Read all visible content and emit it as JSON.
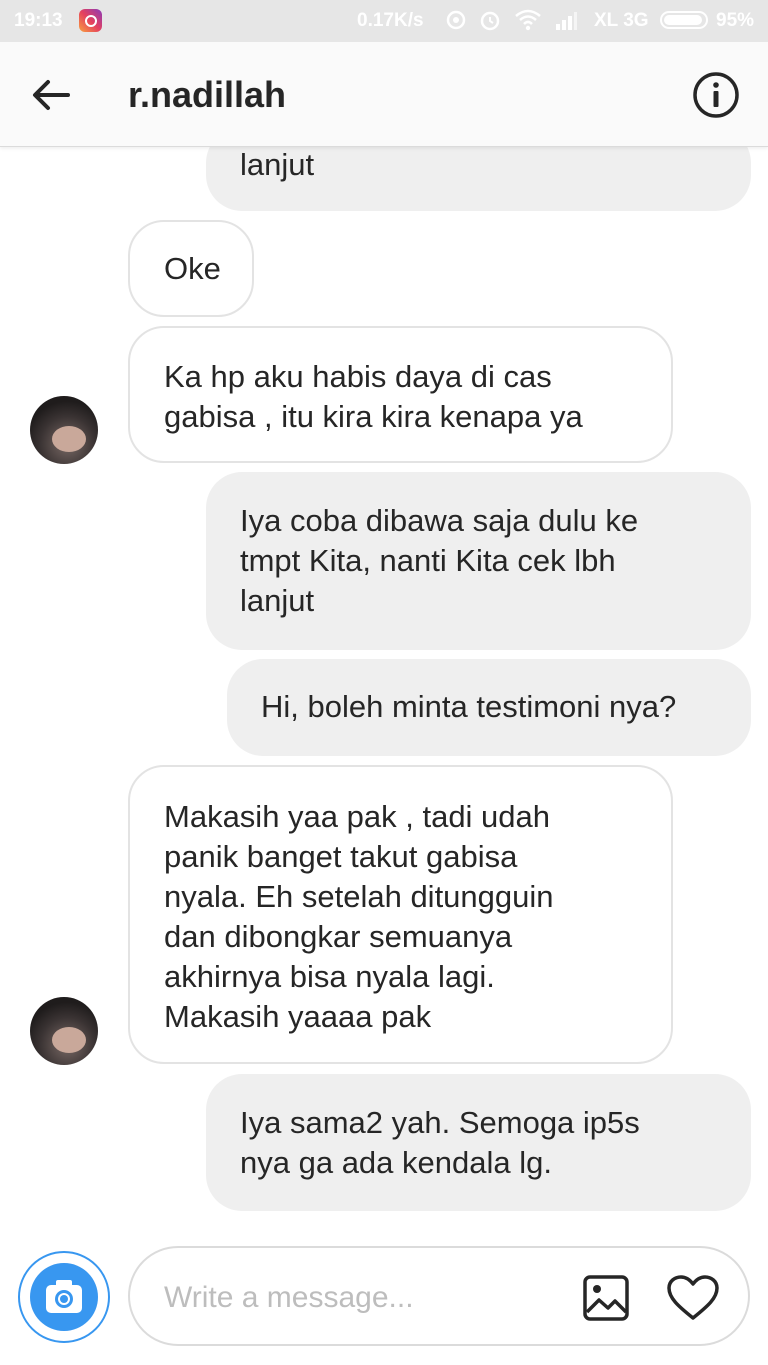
{
  "status_bar": {
    "time": "19:13",
    "network_speed": "0.17K/s",
    "carrier": "XL 3G",
    "battery": "95%",
    "battery_level": 0.95
  },
  "header": {
    "title": "r.nadillah",
    "back_icon": "arrow-left-icon",
    "info_icon": "info-icon"
  },
  "messages": [
    {
      "direction": "outgoing",
      "lines": [
        "lanjut"
      ]
    },
    {
      "direction": "incoming",
      "lines": [
        "Oke"
      ]
    },
    {
      "direction": "incoming",
      "lines": [
        "Ka hp aku habis daya di cas",
        "gabisa , itu kira kira kenapa ya"
      ]
    },
    {
      "direction": "outgoing",
      "lines": [
        "Iya coba dibawa saja dulu ke",
        "tmpt Kita, nanti Kita cek lbh",
        "lanjut"
      ]
    },
    {
      "direction": "outgoing",
      "lines": [
        "Hi, boleh minta testimoni nya?"
      ]
    },
    {
      "direction": "incoming",
      "lines": [
        "Makasih yaa pak , tadi udah",
        "panik banget takut gabisa",
        "nyala. Eh setelah ditungguin",
        "dan dibongkar semuanya",
        "akhirnya bisa nyala lagi.",
        "Makasih yaaaa pak"
      ]
    },
    {
      "direction": "outgoing",
      "lines": [
        "Iya sama2 yah. Semoga ip5s",
        "nya ga ada kendala lg."
      ]
    }
  ],
  "composer": {
    "placeholder": "Write a message...",
    "camera_icon": "camera-icon",
    "gallery_icon": "image-icon",
    "like_icon": "heart-icon"
  },
  "colors": {
    "accent": "#3897f0",
    "outgoing_bubble": "#efefef",
    "incoming_border": "#e3e3e3"
  }
}
